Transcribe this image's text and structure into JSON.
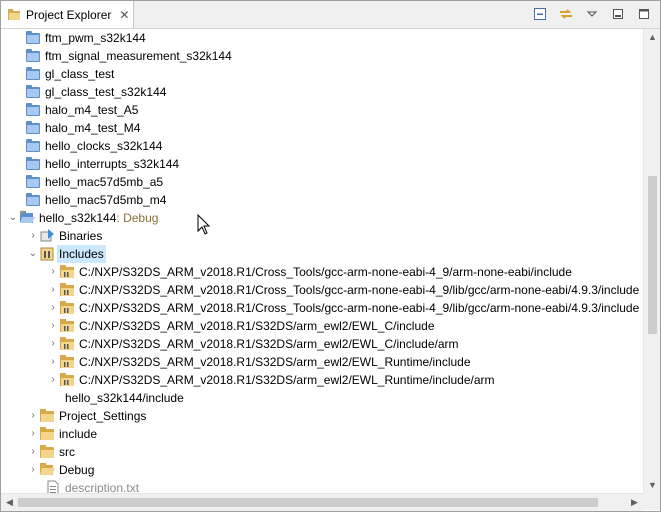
{
  "tab": {
    "label": "Project Explorer",
    "close": "✕"
  },
  "toolbar": {
    "collapse_all": "collapse-all-icon",
    "link_editor": "link-with-editor-icon",
    "view_menu": "view-menu-icon",
    "minimize": "minimize-icon",
    "maximize": "maximize-icon"
  },
  "tree": {
    "projects_top": [
      "ftm_pwm_s32k144",
      "ftm_signal_measurement_s32k144",
      "gl_class_test",
      "gl_class_test_s32k144",
      "halo_m4_test_A5",
      "halo_m4_test_M4",
      "hello_clocks_s32k144",
      "hello_interrupts_s32k144",
      "hello_mac57d5mb_a5",
      "hello_mac57d5mb_m4"
    ],
    "open_project": {
      "name": "hello_s32k144",
      "decoration": ": Debug"
    },
    "binaries": "Binaries",
    "includes": "Includes",
    "include_paths": [
      "C:/NXP/S32DS_ARM_v2018.R1/Cross_Tools/gcc-arm-none-eabi-4_9/arm-none-eabi/include",
      "C:/NXP/S32DS_ARM_v2018.R1/Cross_Tools/gcc-arm-none-eabi-4_9/lib/gcc/arm-none-eabi/4.9.3/include",
      "C:/NXP/S32DS_ARM_v2018.R1/Cross_Tools/gcc-arm-none-eabi-4_9/lib/gcc/arm-none-eabi/4.9.3/include",
      "C:/NXP/S32DS_ARM_v2018.R1/S32DS/arm_ewl2/EWL_C/include",
      "C:/NXP/S32DS_ARM_v2018.R1/S32DS/arm_ewl2/EWL_C/include/arm",
      "C:/NXP/S32DS_ARM_v2018.R1/S32DS/arm_ewl2/EWL_Runtime/include",
      "C:/NXP/S32DS_ARM_v2018.R1/S32DS/arm_ewl2/EWL_Runtime/include/arm"
    ],
    "workspace_include": "hello_s32k144/include",
    "folders": [
      "Project_Settings",
      "include",
      "src",
      "Debug"
    ],
    "file": "description.txt"
  },
  "colors": {
    "selection": "#cce8ff",
    "decoration": "#8b6f37",
    "folder_blue": "#5d8fc9"
  }
}
